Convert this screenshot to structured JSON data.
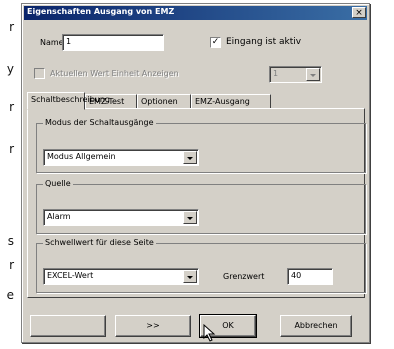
{
  "background_letters": [
    "r",
    "y",
    "r",
    "r",
    "s",
    "r",
    "e"
  ],
  "dialog": {
    "title": "Eigenschaften Ausgang von EMZ",
    "close_label": "×",
    "name_label": "Name",
    "name_value": "1",
    "active_checkbox_checked": true,
    "active_label": "Eingang ist aktiv",
    "disabled_checkbox_label": "Aktuellen Wert Einheit Anzeigen",
    "disabled_select_value": "1",
    "tabs": [
      {
        "label": "Schaltbeschreibung",
        "active": true
      },
      {
        "label": "EMZ-Test",
        "active": false
      },
      {
        "label": "Optionen",
        "active": false
      },
      {
        "label": "EMZ-Ausgang",
        "active": false
      }
    ],
    "groups": {
      "output_mode": {
        "title": "Modus der Schaltausgänge",
        "value": "Modus Allgemein"
      },
      "source": {
        "title": "Quelle",
        "value": "Alarm"
      },
      "threshold": {
        "title": "Schwellwert für diese Seite",
        "value": "EXCEL-Wert",
        "limit_label": "Grenzwert",
        "limit_value": "40"
      }
    },
    "buttons": {
      "back": "",
      "forward": ">>",
      "ok": "OK",
      "cancel": "Abbrechen"
    }
  }
}
